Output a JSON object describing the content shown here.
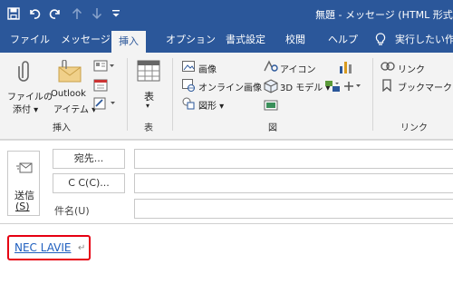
{
  "window": {
    "title": "無題 - メッセージ (HTML 形式)"
  },
  "tabs": [
    "ファイル",
    "メッセージ",
    "挿入",
    "オプション",
    "書式設定",
    "校閲",
    "ヘルプ",
    "実行したい作"
  ],
  "ribbon": {
    "attach_file": [
      "ファイルの",
      "添付 ▾"
    ],
    "outlook_item": [
      "Outlook",
      "アイテム ▾"
    ],
    "table": "表",
    "picture": "画像",
    "online_pictures": "オンライン画像",
    "shapes": "図形 ▾",
    "icons": "アイコン",
    "models_3d": "3D モデル ▾",
    "link": "リンク",
    "bookmark": "ブックマーク",
    "group_insert": "挿入",
    "group_table": "表",
    "group_illustrations": "図",
    "group_links": "リンク"
  },
  "compose": {
    "send": [
      "送信",
      "(S)"
    ],
    "to_button": "宛先...",
    "cc_button": "C C(C)...",
    "subject_label": "件名(U)"
  },
  "body": {
    "link_text": "NEC LAVIE",
    "paragraph_mark": "↵"
  },
  "colors": {
    "titlebar": "#2b579a",
    "ribbon": "#f3f3f3",
    "highlight": "#e60012",
    "link": "#1f5fbf"
  }
}
